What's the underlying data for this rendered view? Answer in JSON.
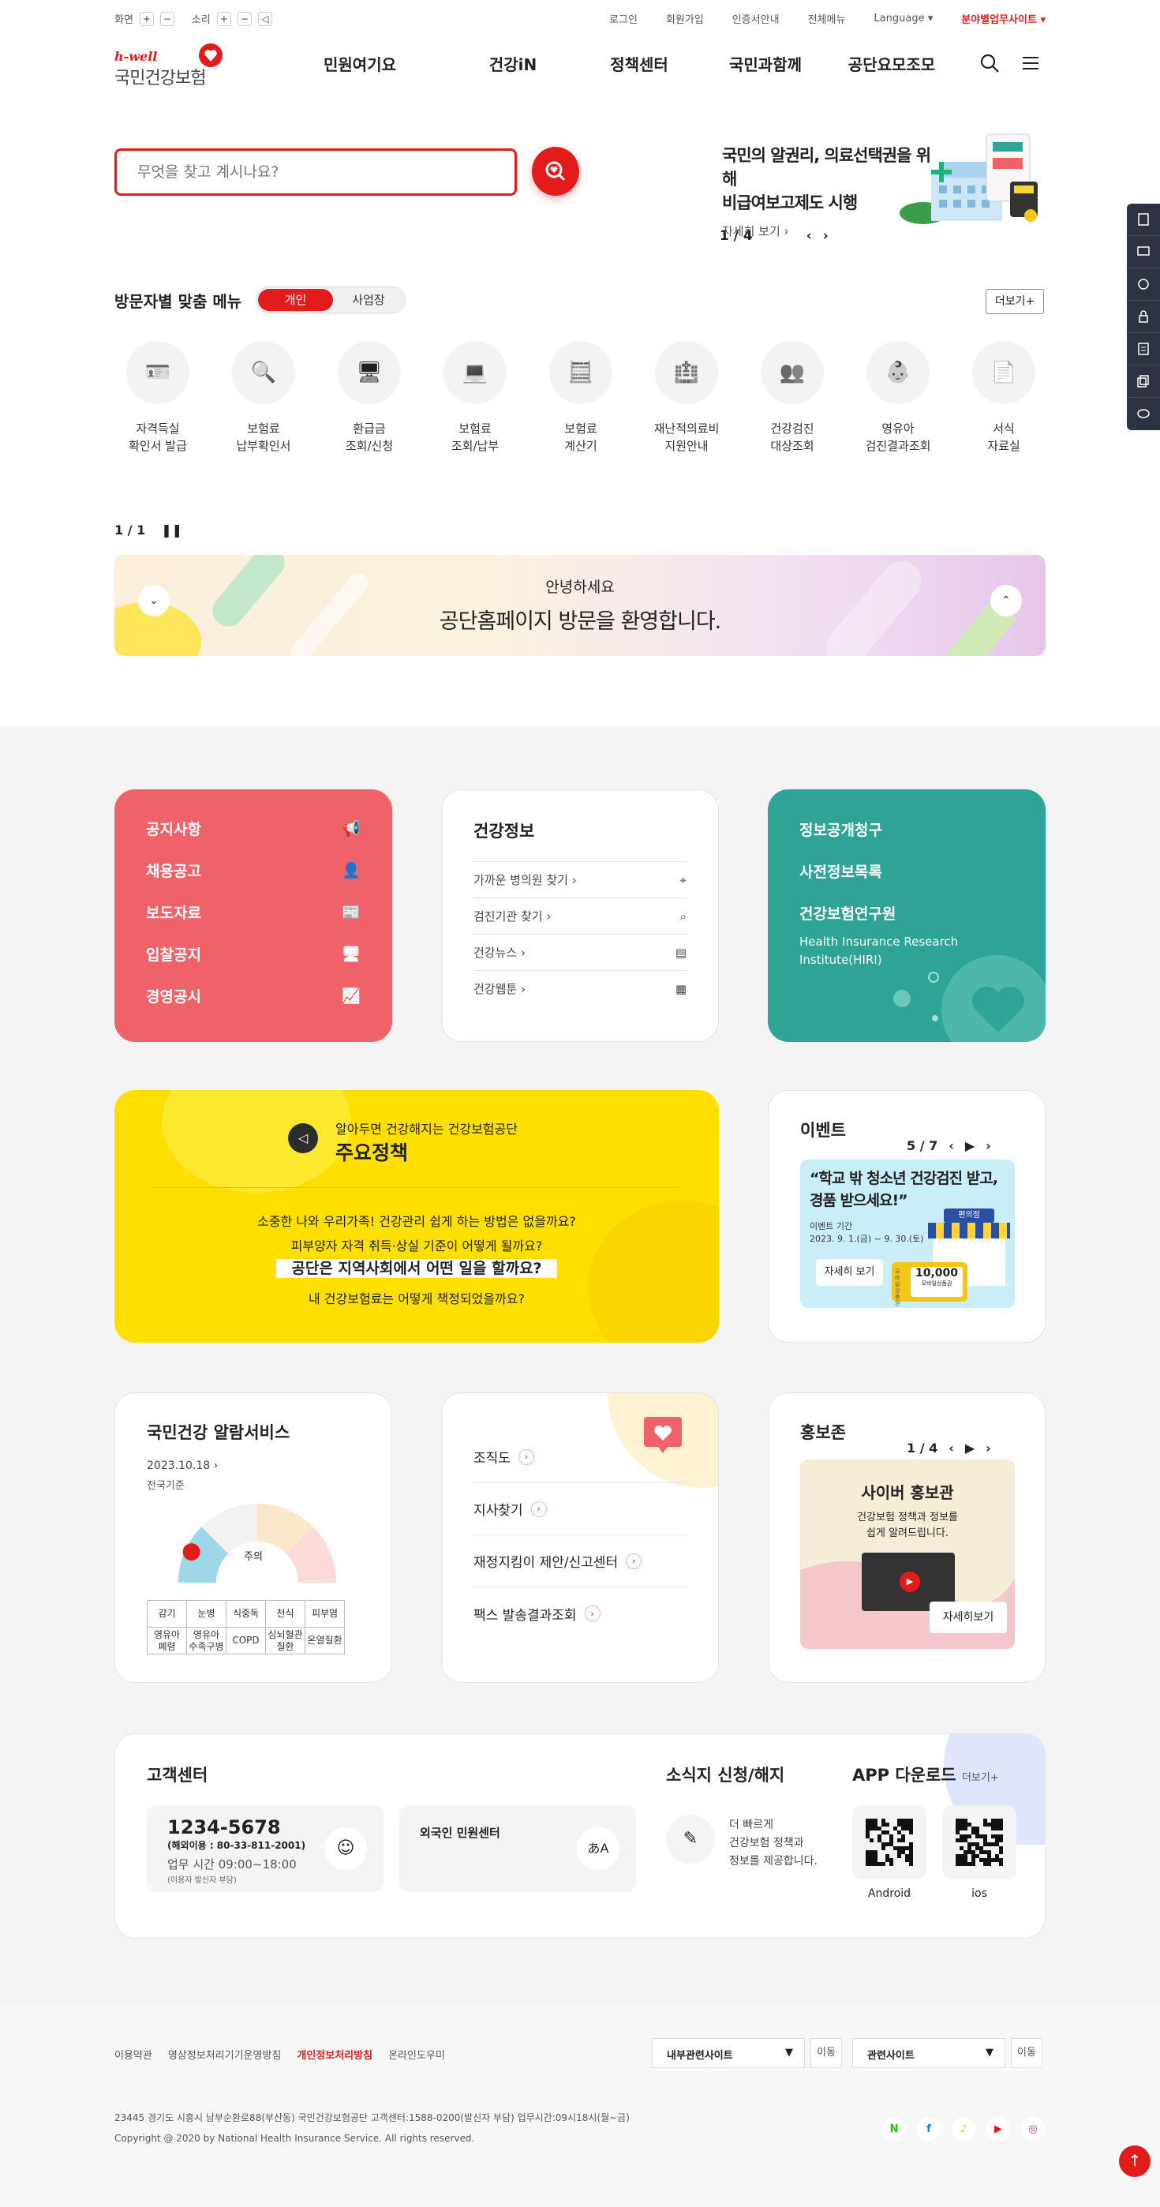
{
  "util": {
    "screen_label": "화면",
    "sound_label": "소리",
    "links": [
      "로그인",
      "회원가입",
      "인증서안내",
      "전체메뉴",
      "Language"
    ],
    "dept_site": "분야별업무사이트"
  },
  "logo": {
    "sub": "h-well",
    "main": "국민건강보험"
  },
  "gnb": [
    "민원여기요",
    "건강iN",
    "정책센터",
    "국민과함께",
    "공단요모조모"
  ],
  "search": {
    "placeholder": "무엇을 찾고 계시나요?"
  },
  "notice": {
    "title1": "국민의 알권리, 의료선택권을 위해",
    "title2": "비급여보고제도 시행",
    "detail": "자세히 보기",
    "page": "1 / 4"
  },
  "visitor": {
    "title": "방문자별 맞춤 메뉴",
    "tab_personal": "개인",
    "tab_business": "사업장",
    "more": "더보기+",
    "items": [
      {
        "label": "자격득실\n확인서 발급",
        "icon": "id-card-icon"
      },
      {
        "label": "보험료\n납부확인서",
        "icon": "receipt-search-icon"
      },
      {
        "label": "환급금\n조회/신청",
        "icon": "monitor-refund-icon"
      },
      {
        "label": "보험료\n조회/납부",
        "icon": "computer-pay-icon"
      },
      {
        "label": "보험료\n계산기",
        "icon": "calculator-icon"
      },
      {
        "label": "재난적의료비\n지원안내",
        "icon": "medical-aid-icon"
      },
      {
        "label": "건강검진\n대상조회",
        "icon": "checkup-search-icon"
      },
      {
        "label": "영유아\n검진결과조회",
        "icon": "infant-icon"
      },
      {
        "label": "서식\n자료실",
        "icon": "document-icon"
      }
    ]
  },
  "banner": {
    "page": "1 / 1",
    "line1": "안녕하세요",
    "line2": "공단홈페이지 방문을 환영합니다."
  },
  "red_card": [
    "공지사항",
    "채용공고",
    "보도자료",
    "입찰공지",
    "경영공시"
  ],
  "health_info": {
    "title": "건강정보",
    "items": [
      "가까운 병의원 찾기",
      "검진기관 찾기",
      "건강뉴스",
      "건강웹툰"
    ]
  },
  "teal_card": {
    "items": [
      "정보공개청구",
      "사전정보목록",
      "건강보험연구원"
    ],
    "hiri": "Health Insurance Research Institute(HIRI)"
  },
  "policy": {
    "small": "알아두면 건강해지는 건강보험공단",
    "title": "주요정책",
    "q1": "소중한 나와 우리가족! 건강관리 쉽게 하는 방법은 없을까요?",
    "q2": "피부양자 자격 취득·상실 기준이 어떻게 될까요?",
    "q3": "공단은 지역사회에서 어떤 일을 할까요?",
    "q4": "내 건강보험료는 어떻게 책정되었을까요?"
  },
  "event": {
    "title": "이벤트",
    "page": "5 / 7",
    "headline1": "“학교 밖 청소년 건강검진 받고,",
    "headline2": "경품 받으세요!”",
    "period_label": "이벤트 기간",
    "period": "2023. 9. 1.(금) ~ 9. 30.(토)",
    "detail": "자세히 보기",
    "store": "편의점",
    "coupon_value": "10,000",
    "coupon_label": "모바일상품권",
    "coupon_side": "모바일 상품권"
  },
  "alarm": {
    "title": "국민건강 알람서비스",
    "date": "2023.10.18",
    "basis": "전국기준",
    "level": "주의",
    "diseases": [
      [
        "감기",
        "눈병",
        "식중독",
        "천식",
        "피부염"
      ],
      [
        "영유아\n폐렴",
        "영유아\n수족구병",
        "COPD",
        "심뇌혈관\n질환",
        "온열질환"
      ]
    ],
    "colors": {
      "safe": "#9ed8e8",
      "caution": "#f2f2f2",
      "warn": "#fbe7c9",
      "danger": "#fbdada",
      "marker": "#e41b1b"
    }
  },
  "links_card": [
    "조직도",
    "지사찾기",
    "재정지킴이 제안/신고센터",
    "팩스 발송결과조회"
  ],
  "promo": {
    "title": "홍보존",
    "page": "1 / 4",
    "heading": "사이버 홍보관",
    "desc1": "건강보험 정책과 정보를",
    "desc2": "쉽게 알려드립니다.",
    "detail": "자세히보기"
  },
  "customer": {
    "title": "고객센터",
    "phone": "1234-5678",
    "overseas": "(해외이용 : 80-33-811-2001)",
    "hours": "업무 시간 09:00~18:00",
    "note": "(이용자 발신자 부담)",
    "foreign": "외국인 민원센터"
  },
  "newsletter": {
    "title": "소식지 신청/해지",
    "desc": [
      "더 빠르게",
      "건강보험 정책과",
      "정보를 제공합니다."
    ]
  },
  "app": {
    "title": "APP 다운로드",
    "more": "더보기+",
    "android": "Android",
    "ios": "ios"
  },
  "footer": {
    "links": [
      "이용약관",
      "영상정보처리기기운영방침",
      "개인정보처리방침",
      "온라인도우미"
    ],
    "select1": "내부관련사이트",
    "select2": "관련사이트",
    "move": "이동",
    "addr": "23445 경기도 시흥시 남부순환로88(부산동) 국민건강보험공단 고객센터:1588-0200(발신자 부담) 업무시간:09시18시(월~금)",
    "copy": "Copyright @ 2020 by National Health Insurance Service. All rights reserved.",
    "sns": [
      "N",
      "f",
      "♪",
      "▶",
      "◎"
    ]
  },
  "colors": {
    "brand": "#e41b1b",
    "red_card": "#f0626a",
    "teal": "#2ea396",
    "yellow": "#ffdf00"
  }
}
